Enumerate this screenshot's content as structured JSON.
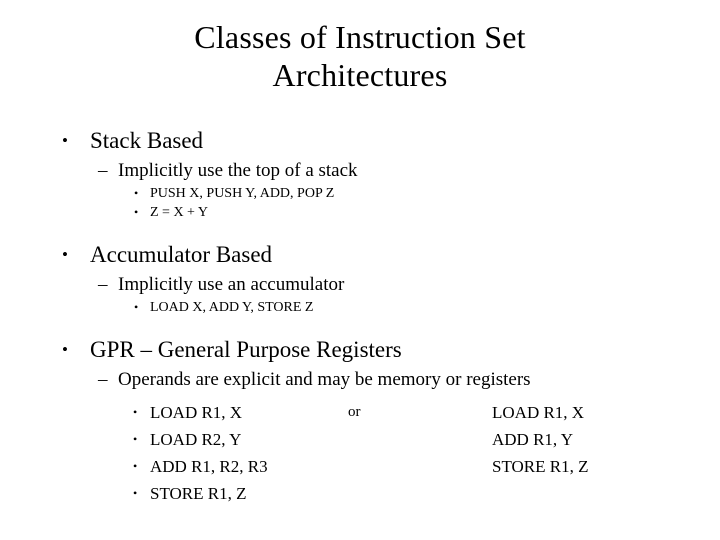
{
  "slide": {
    "background_color": "#ffffff",
    "text_color": "#000000",
    "title": {
      "line1": "Classes of Instruction Set",
      "line2": "Architectures"
    },
    "bullet_glyphs": {
      "level1": "•",
      "level2": "–",
      "level3": "•"
    },
    "sections": [
      {
        "heading": "Stack Based",
        "sub": "Implicitly use the top of a stack",
        "items": [
          "PUSH X, PUSH Y, ADD, POP Z",
          "Z = X + Y"
        ]
      },
      {
        "heading": "Accumulator Based",
        "sub": "Implicitly use an accumulator",
        "items": [
          "LOAD X, ADD Y, STORE Z"
        ]
      },
      {
        "heading": "GPR – General Purpose Registers",
        "sub": "Operands are explicit and may be memory or registers",
        "code_left": [
          "LOAD R1, X",
          "LOAD R2, Y",
          "ADD R1, R2, R3",
          "STORE R1, Z"
        ],
        "separator": "or",
        "code_right": [
          "LOAD R1, X",
          "ADD R1, Y",
          "STORE R1, Z"
        ]
      }
    ]
  }
}
